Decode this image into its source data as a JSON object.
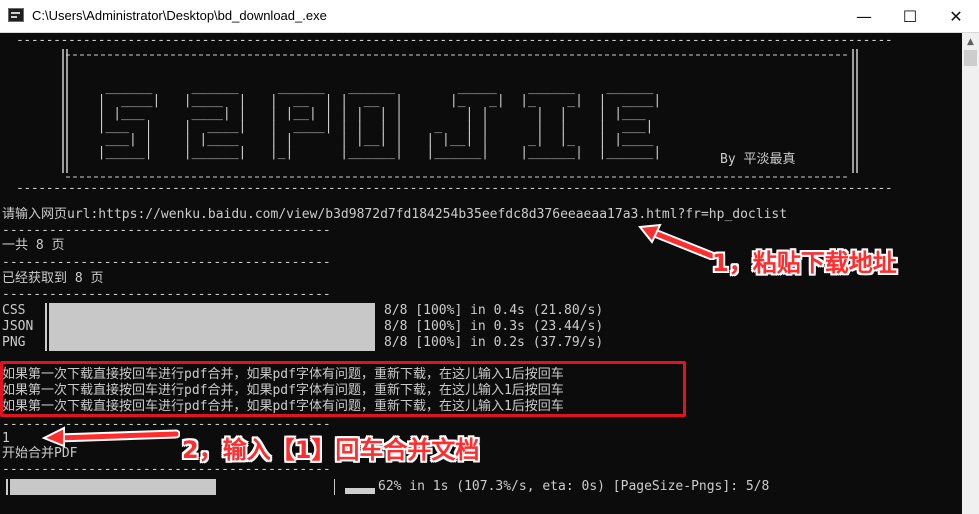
{
  "window": {
    "title": "C:\\Users\\Administrator\\Desktop\\bd_download_.exe",
    "min_glyph": "—",
    "max_glyph": "☐",
    "close_glyph": "✕"
  },
  "banner": {
    "top_rule": "----------------------------------------------------------------------------------------------------------------------",
    "ascii_art": [
      "   ______     ______     ______   ______        _____    ______    ______",
      "  |  ____|   |____  |   |  __  | |  __  |      |_   _|  |_    _|  |  ____|",
      "  | |___      ____| |   | |__| | | |  | |        | |      |  |    | |___",
      "  |___  |    |  ____|   |  ____| | |  | |    _   | |      |  |    |  ___|",
      "   ___| |    | |____    | |      | |__| |   | |__| |     _|  |_   | |____",
      "  |_____|    |______|   |_|      |______|   |______|    |______|  |______|"
    ],
    "byline": "By 平淡最真",
    "bottom_rule": "----------------------------------------------------------------------------------------------------------------------"
  },
  "console": {
    "url_prompt": "请输入网页url:https://wenku.baidu.com/view/b3d9872d7fd184254b35eefdc8d376eeaeaa17a3.html?fr=hp_doclist",
    "sep": "------------------------------------------",
    "total_pages": "一共 8 页",
    "fetched": "已经获取到 8 页",
    "progress_rows": [
      {
        "label": "CSS",
        "stats": "8/8 [100%] in 0.4s (21.80/s)",
        "fill": 1.0
      },
      {
        "label": "JSON",
        "stats": "8/8 [100%] in 0.3s (23.44/s)",
        "fill": 1.0
      },
      {
        "label": "PNG",
        "stats": "8/8 [100%] in 0.2s (37.79/s)",
        "fill": 1.0
      }
    ],
    "merge_hint": [
      "如果第一次下载直接按回车进行pdf合并，如果pdf字体有问题，重新下载，在这儿输入1后按回车",
      "如果第一次下载直接按回车进行pdf合并，如果pdf字体有问题，重新下载，在这儿输入1后按回车",
      "如果第一次下载直接按回车进行pdf合并，如果pdf字体有问题，重新下载，在这儿输入1后按回车"
    ],
    "user_input": "1",
    "merge_start": "开始合并PDF",
    "final_progress": {
      "stats": "62% in 1s (107.3%/s, eta: 0s) [PageSize-Pngs]: 5/8",
      "fill": 0.62
    }
  },
  "annotations": {
    "step1": "1，粘贴下载地址",
    "step2": "2，输入【1】回车合并文档",
    "color": "#ff2d2d"
  }
}
